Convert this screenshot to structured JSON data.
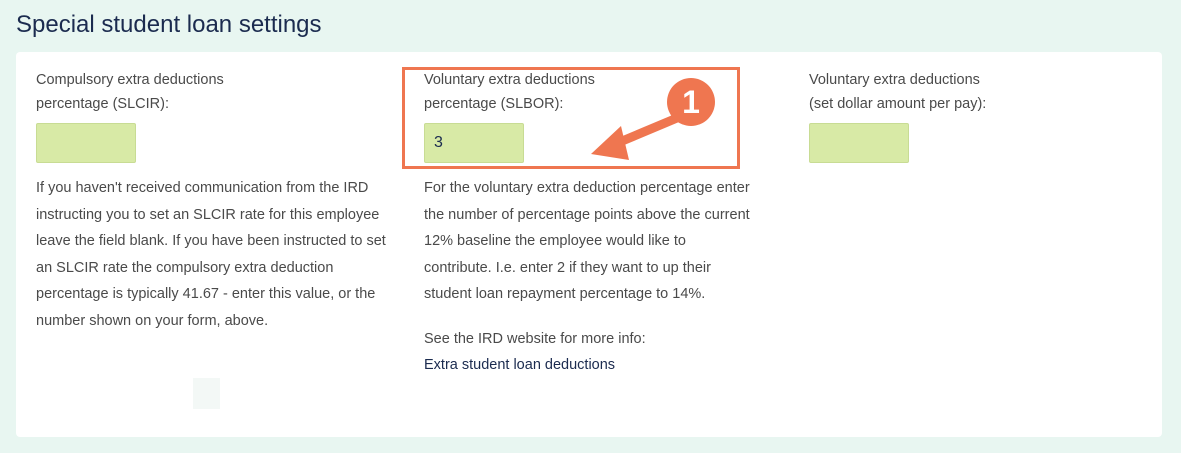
{
  "section": {
    "title": "Special student loan settings"
  },
  "slcir": {
    "label_line1": "Compulsory extra deductions",
    "label_line2": "percentage (SLCIR):",
    "value": "",
    "help": "If you haven't received communication from the IRD instructing you to set an SLCIR rate for this employee leave the field blank. If you have been instructed to set an SLCIR rate the compulsory extra deduction percentage is typically 41.67 - enter this value, or the number shown on your form, above."
  },
  "slbor": {
    "label_line1": "Voluntary extra deductions",
    "label_line2": "percentage (SLBOR):",
    "value": "3",
    "help": "For the voluntary extra deduction percentage enter the number of percentage points above the current 12% baseline the employee would like to contribute. I.e. enter 2 if they want to up their student loan repayment percentage to 14%.",
    "more_info": "See the IRD website for more info:",
    "link": "Extra student loan deductions"
  },
  "dollar": {
    "label_line1": "Voluntary extra deductions",
    "label_line2": "(set dollar amount per pay):",
    "value": ""
  },
  "annotation": {
    "badge": "1",
    "color": "#ef7650"
  },
  "colors": {
    "field_bg": "#d8eaa6",
    "page_bg": "#e8f6f1",
    "title": "#1b2b4f"
  }
}
